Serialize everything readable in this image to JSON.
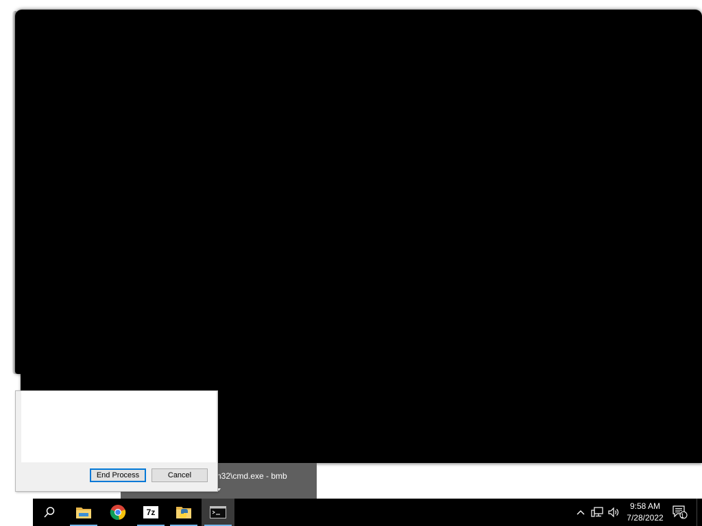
{
  "dialog": {
    "end_process_label": "End Process",
    "cancel_label": "Cancel"
  },
  "taskbar_preview": {
    "title": "n32\\cmd.exe - bmb"
  },
  "taskbar": {
    "items": [
      {
        "name": "search-icon"
      },
      {
        "name": "file-explorer-icon"
      },
      {
        "name": "chrome-icon"
      },
      {
        "name": "7zip-icon",
        "label": "7z"
      },
      {
        "name": "python-folder-icon"
      },
      {
        "name": "cmd-icon"
      }
    ],
    "clock": {
      "time": "9:58 AM",
      "date": "7/28/2022"
    },
    "notification_count": "1"
  },
  "colors": {
    "taskbar_bg": "#000000",
    "accent": "#0078d7",
    "active_underline": "#76b9ed"
  }
}
